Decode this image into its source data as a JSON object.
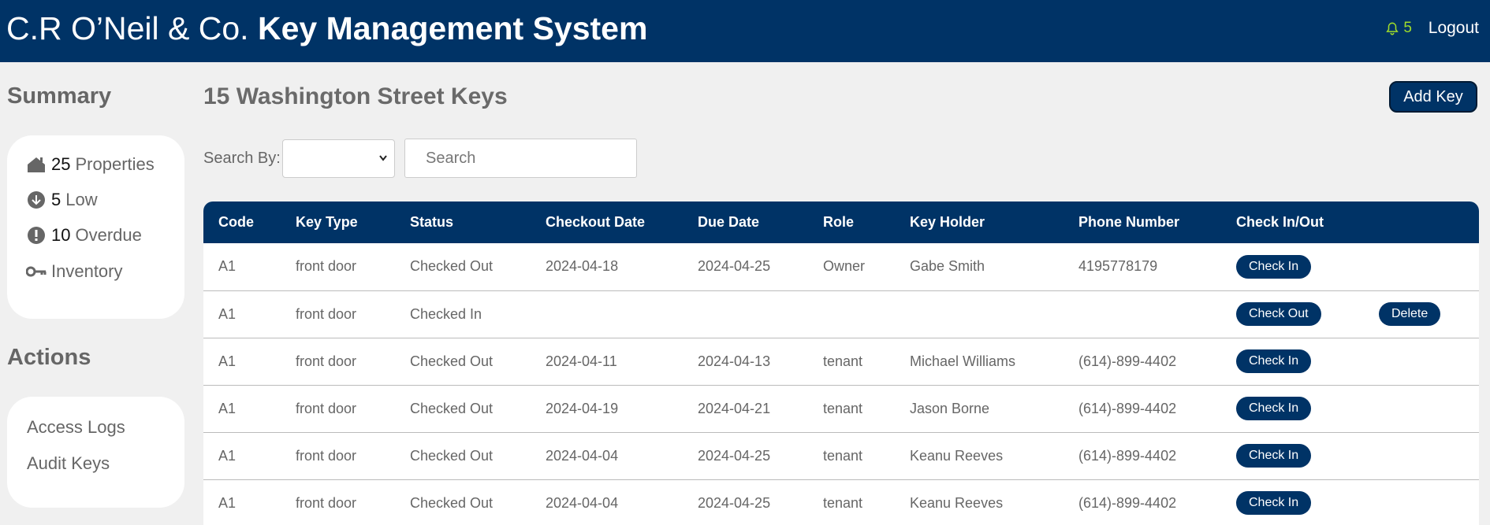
{
  "header": {
    "brand_prefix": "C.R O’Neil & Co.",
    "brand_title": "Key Management System",
    "notification_count": "5",
    "logout_label": "Logout"
  },
  "sidebar": {
    "summary_heading": "Summary",
    "summary": [
      {
        "count": "25",
        "label": "Properties",
        "icon": "house-icon"
      },
      {
        "count": "5",
        "label": "Low",
        "icon": "down-arrow-circle-icon"
      },
      {
        "count": "10",
        "label": "Overdue",
        "icon": "exclamation-circle-icon"
      },
      {
        "count": "",
        "label": "Inventory",
        "icon": "key-icon"
      }
    ],
    "actions_heading": "Actions",
    "actions": [
      {
        "label": "Access Logs"
      },
      {
        "label": "Audit Keys"
      }
    ]
  },
  "main": {
    "title": "15 Washington Street Keys",
    "add_key_label": "Add Key",
    "search_by_label": "Search By:",
    "search_select_value": "",
    "search_placeholder": "Search"
  },
  "table": {
    "headers": [
      "Code",
      "Key Type",
      "Status",
      "Checkout Date",
      "Due Date",
      "Role",
      "Key Holder",
      "Phone Number",
      "Check In/Out",
      ""
    ],
    "rows": [
      {
        "code": "A1",
        "key_type": "front door",
        "status": "Checked Out",
        "checkout_date": "2024-04-18",
        "due_date": "2024-04-25",
        "role": "Owner",
        "holder": "Gabe Smith",
        "phone": "4195778179",
        "action": "Check In",
        "delete": ""
      },
      {
        "code": "A1",
        "key_type": "front door",
        "status": "Checked In",
        "checkout_date": "",
        "due_date": "",
        "role": "",
        "holder": "",
        "phone": "",
        "action": "Check Out",
        "delete": "Delete"
      },
      {
        "code": "A1",
        "key_type": "front door",
        "status": "Checked Out",
        "checkout_date": "2024-04-11",
        "due_date": "2024-04-13",
        "role": "tenant",
        "holder": "Michael Williams",
        "phone": "(614)-899-4402",
        "action": "Check In",
        "delete": ""
      },
      {
        "code": "A1",
        "key_type": "front door",
        "status": "Checked Out",
        "checkout_date": "2024-04-19",
        "due_date": "2024-04-21",
        "role": "tenant",
        "holder": "Jason Borne",
        "phone": "(614)-899-4402",
        "action": "Check In",
        "delete": ""
      },
      {
        "code": "A1",
        "key_type": "front door",
        "status": "Checked Out",
        "checkout_date": "2024-04-04",
        "due_date": "2024-04-25",
        "role": "tenant",
        "holder": "Keanu Reeves",
        "phone": "(614)-899-4402",
        "action": "Check In",
        "delete": ""
      },
      {
        "code": "A1",
        "key_type": "front door",
        "status": "Checked Out",
        "checkout_date": "2024-04-04",
        "due_date": "2024-04-25",
        "role": "tenant",
        "holder": "Keanu Reeves",
        "phone": "(614)-899-4402",
        "action": "Check In",
        "delete": ""
      }
    ]
  },
  "colors": {
    "primary": "#003366",
    "notification": "#9fdc2b",
    "background": "#f0f0f0"
  }
}
